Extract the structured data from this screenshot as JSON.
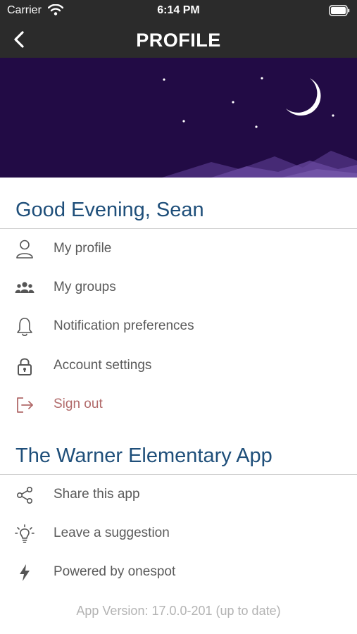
{
  "status_bar": {
    "carrier": "Carrier",
    "time": "6:14 PM"
  },
  "nav": {
    "title": "PROFILE"
  },
  "colors": {
    "banner": "#220b45",
    "section_title": "#1f4f7a",
    "sign_out": "#b16a6a",
    "nav_bg": "#2b2b2b"
  },
  "greeting": "Good Evening, Sean",
  "account_menu": [
    {
      "label": "My profile",
      "icon": "person-icon"
    },
    {
      "label": "My groups",
      "icon": "group-icon"
    },
    {
      "label": "Notification preferences",
      "icon": "bell-icon"
    },
    {
      "label": "Account settings",
      "icon": "lock-icon"
    },
    {
      "label": "Sign out",
      "icon": "sign-out-icon"
    }
  ],
  "app_section_title": "The Warner Elementary App",
  "app_menu": [
    {
      "label": "Share this app",
      "icon": "share-icon"
    },
    {
      "label": "Leave a suggestion",
      "icon": "lightbulb-icon"
    },
    {
      "label": "Powered by onespot",
      "icon": "lightning-icon"
    }
  ],
  "app_version": "App Version: 17.0.0-201 (up to date)"
}
